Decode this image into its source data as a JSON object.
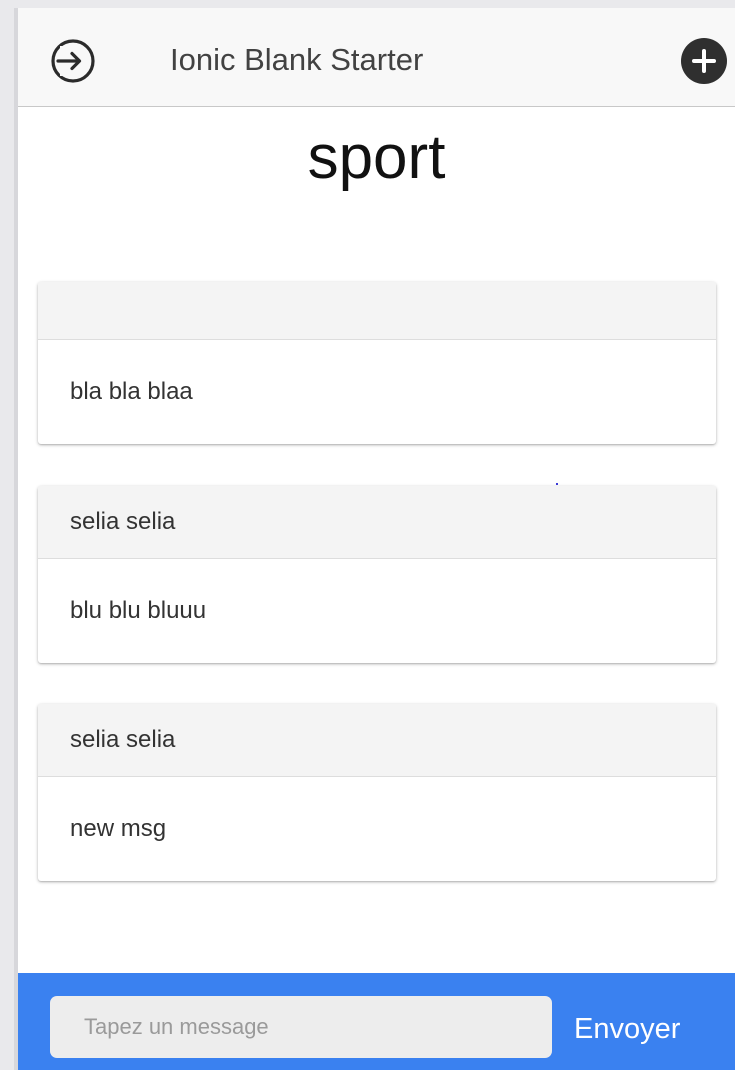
{
  "header": {
    "title": "Ionic Blank Starter",
    "left_icon": "login-icon",
    "right_icon": "add-circle-icon"
  },
  "page": {
    "title": "sport"
  },
  "messages": [
    {
      "author": "",
      "text": "bla bla blaa"
    },
    {
      "author": "selia selia",
      "text": "blu blu bluuu"
    },
    {
      "author": "selia selia",
      "text": "new msg"
    }
  ],
  "footer": {
    "input_placeholder": "Tapez un message",
    "input_value": "",
    "send_label": "Envoyer"
  },
  "colors": {
    "footer_bg": "#3a81f0",
    "header_bg": "#f8f8f8",
    "card_header_bg": "#f4f4f4"
  }
}
